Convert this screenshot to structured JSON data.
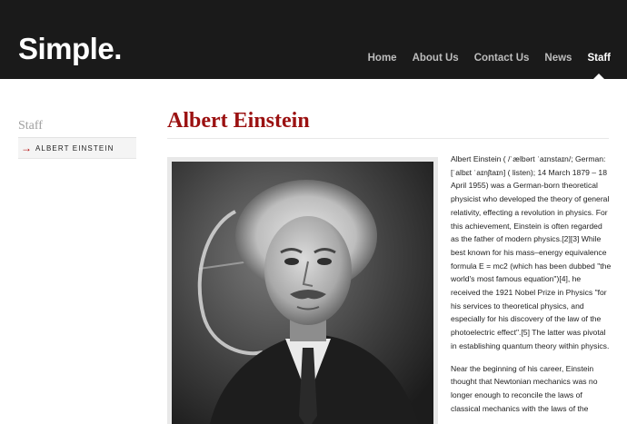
{
  "header": {
    "logo": "Simple.",
    "nav": [
      {
        "label": "Home",
        "active": false
      },
      {
        "label": "About Us",
        "active": false
      },
      {
        "label": "Contact Us",
        "active": false
      },
      {
        "label": "News",
        "active": false
      },
      {
        "label": "Staff",
        "active": true
      }
    ]
  },
  "sidebar": {
    "title": "Staff",
    "items": [
      {
        "label": "ALBERT EINSTEIN",
        "icon": "arrow-right-icon"
      }
    ]
  },
  "main": {
    "title": "Albert Einstein",
    "paragraphs": [
      "Albert Einstein ( /ˈælbərt ˈaɪnstaɪn/; German: [ˈalbɛt ˈaɪnʃtaɪn] ( listen); 14 March 1879 – 18 April 1955) was a German-born theoretical physicist who developed the theory of general relativity, effecting a revolution in physics. For this achievement, Einstein is often regarded as the father of modern physics.[2][3] While best known for his mass–energy equivalence formula E = mc2 (which has been dubbed \"the world's most famous equation\")[4], he received the 1921 Nobel Prize in Physics \"for his services to theoretical physics, and especially for his discovery of the law of the photoelectric effect\".[5] The latter was pivotal in establishing quantum theory within physics.",
      "Near the beginning of his career, Einstein thought that Newtonian mechanics was no longer enough to reconcile the laws of classical mechanics with the laws of the"
    ]
  },
  "colors": {
    "header_bg": "#1a1a1a",
    "accent": "#9b1111",
    "nav_text": "#bdbdbd",
    "nav_active": "#ffffff"
  }
}
